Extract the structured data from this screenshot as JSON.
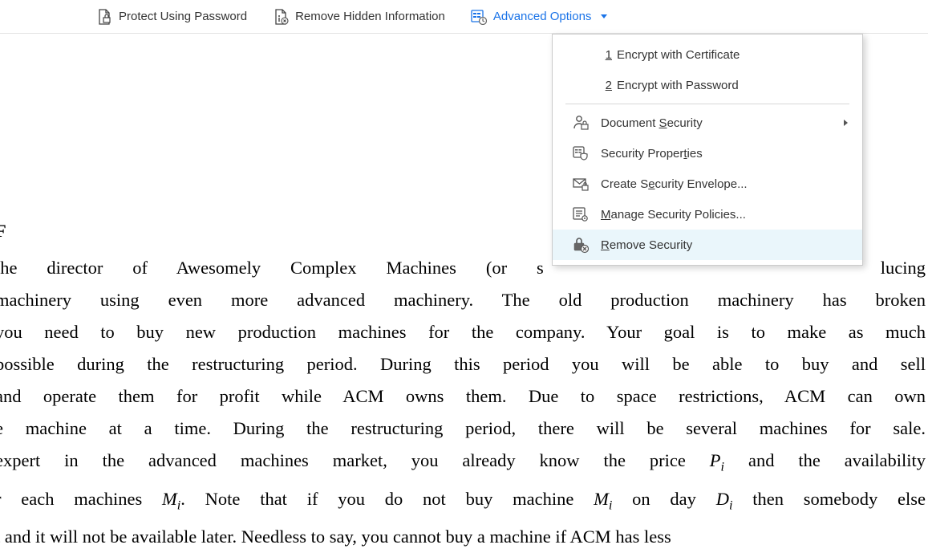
{
  "toolbar": {
    "protect_label": "Protect Using Password",
    "remove_hidden_label": "Remove Hidden Information",
    "advanced_label": "Advanced Options"
  },
  "menu": {
    "encrypt_cert": {
      "num": "1",
      "label": "Encrypt with Certificate"
    },
    "encrypt_pwd": {
      "num": "2",
      "label": "Encrypt with Password"
    },
    "doc_security": {
      "pre": "Document ",
      "u": "S",
      "post": "ecurity"
    },
    "sec_props": {
      "pre": "Security Proper",
      "u": "t",
      "post": "ies"
    },
    "envelope": {
      "pre": "Create S",
      "u": "e",
      "post": "curity Envelope..."
    },
    "manage": {
      "pre": "",
      "u": "M",
      "post": "anage Security Policies..."
    },
    "remove": {
      "pre": "",
      "u": "R",
      "post": "emove Security"
    }
  },
  "doc": {
    "heading": " F",
    "l1_a": "the director of Awesomely Complex Machines (or s",
    "l1_b": "lucing",
    "l2": " machinery using even more advanced machinery. The old production machinery has broken",
    "l3": " you need to buy new production machines for the company. Your goal is to make as much",
    "l4": " possible during the restructuring period. During this period you will be able to buy and sell",
    "l5": " and operate them for profit while ACM owns them. Due to space restrictions, ACM can own",
    "l6": "e machine at a time. During the restructuring period, there will be several machines for sale.",
    "l7_a": " expert in the advanced machines market, you already know the price ",
    "l7_p": "P",
    "l7_i": "i",
    "l7_b": " and the availability",
    "l8_a": "r each machines ",
    "l8_m": "M",
    "l8_i1": "i",
    "l8_b": ". Note that if you do not buy machine ",
    "l8_m2": "M",
    "l8_i2": "i",
    "l8_c": " on day ",
    "l8_d": "D",
    "l8_i3": "i",
    "l8_e": " then somebody else",
    "l9": "t and it will not be available later. Needless to say, you cannot buy a machine if ACM has less"
  }
}
